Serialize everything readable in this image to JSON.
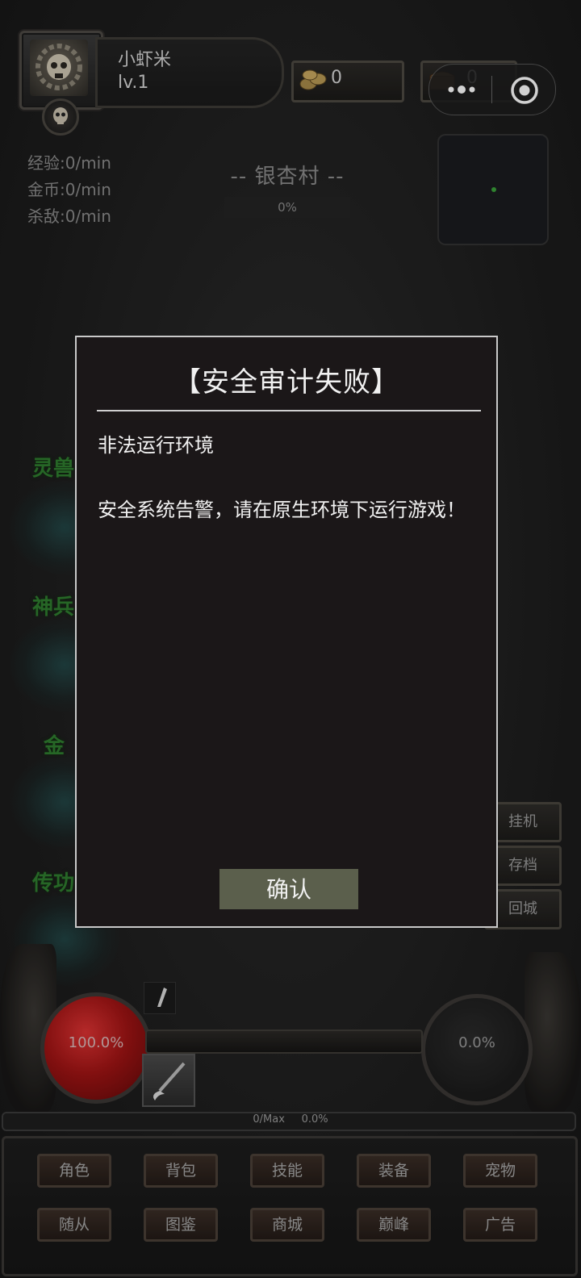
{
  "player": {
    "name": "小虾米",
    "level": "lv.1"
  },
  "resources": {
    "coins": "0",
    "chest": "0"
  },
  "mini_program_capsule": {
    "more_icon": "three-dots-icon",
    "close_icon": "target-circle-icon"
  },
  "stats": {
    "exp": "经验:0/min",
    "gold": "金币:0/min",
    "kills": "杀敌:0/min"
  },
  "location": {
    "name": "-- 银杏村 --",
    "progress": "0%"
  },
  "side_labels": [
    "灵兽",
    "神兵",
    "金",
    "传功"
  ],
  "right_actions": [
    "挂机",
    "存档",
    "回城"
  ],
  "dialog": {
    "title": "【安全审计失败】",
    "subtitle": "非法运行环境",
    "message": "安全系统告警，请在原生环境下运行游戏！",
    "confirm_label": "确认"
  },
  "hud": {
    "hp": "100.0%",
    "mp": "0.0%",
    "xp_text": "0/Max     0.0%"
  },
  "menu_row1": [
    "角色",
    "背包",
    "技能",
    "装备",
    "宠物"
  ],
  "menu_row2": [
    "随从",
    "图鉴",
    "商城",
    "巅峰",
    "广告"
  ],
  "colors": {
    "dialog_bg": "#1b1718",
    "confirm_bg": "#5b5f4c",
    "side_label": "#2f7d2f"
  }
}
